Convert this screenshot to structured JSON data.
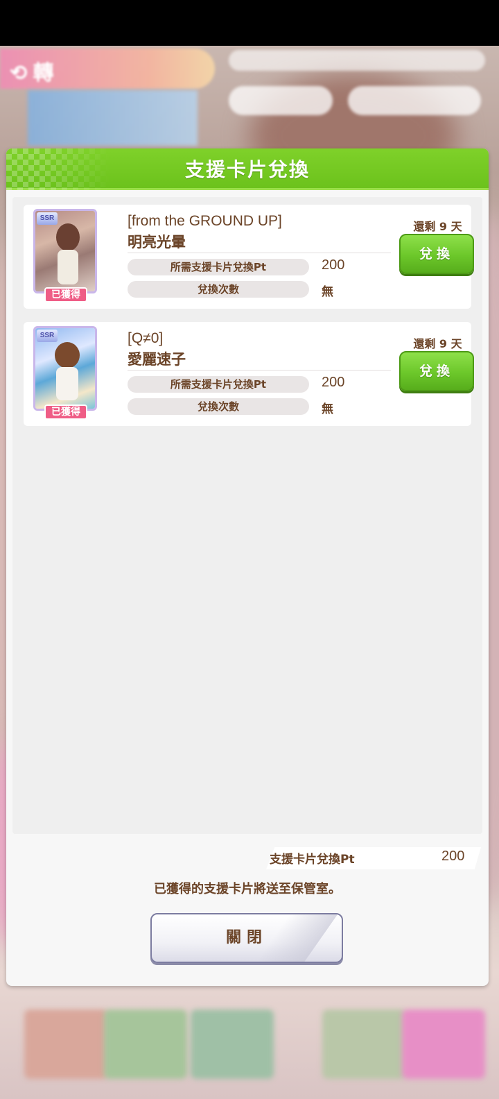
{
  "dialog": {
    "title": "支援卡片兌換"
  },
  "cards": [
    {
      "rarity": "SSR",
      "owned_label": "已獲得",
      "name_line1": "[from the GROUND UP]",
      "name_line2": "明亮光暈",
      "cost_label": "所需支援卡片兌換Pt",
      "cost_value": "200",
      "count_label": "兌換次數",
      "count_value": "無",
      "remaining": "還剩 9 天",
      "button": "兌換"
    },
    {
      "rarity": "SSR",
      "owned_label": "已獲得",
      "name_line1": "[Q≠0]",
      "name_line2": "愛麗速子",
      "cost_label": "所需支援卡片兌換Pt",
      "cost_value": "200",
      "count_label": "兌換次數",
      "count_value": "無",
      "remaining": "還剩 9 天",
      "button": "兌換"
    }
  ],
  "footer": {
    "pt_label": "支援卡片兌換Pt",
    "pt_value": "200",
    "notice": "已獲得的支援卡片將送至保管室。",
    "close_button": "關閉"
  },
  "colors": {
    "accent_green": "#6cc72a",
    "text_brown": "#6b4428",
    "owned_pink": "#ef5d86"
  }
}
